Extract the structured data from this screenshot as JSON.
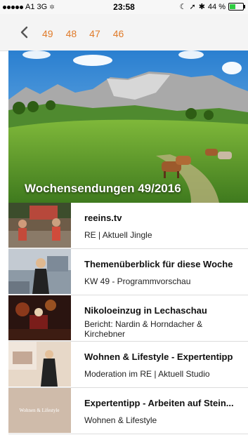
{
  "status_bar": {
    "carrier": "A1",
    "network": "3G",
    "time": "23:58",
    "battery": "44 %",
    "battery_level": 0.44
  },
  "nav": {
    "back_icon": "chevron-left-icon",
    "weeks": [
      "49",
      "48",
      "47",
      "46"
    ],
    "accent": "#e07b2a"
  },
  "hero": {
    "title": "Wochensendungen 49/2016"
  },
  "items": [
    {
      "title": "reeins.tv",
      "subtitle": "RE | Aktuell Jingle"
    },
    {
      "title": "Themenüberblick für diese Woche",
      "subtitle": "KW 49 - Programmvorschau"
    },
    {
      "title": "Nikoloeinzug in Lechaschau",
      "subtitle": "Bericht: Nardin & Horndacher & Kirchebner"
    },
    {
      "title": "Wohnen & Lifestyle - Expertentipp",
      "subtitle": "Moderation im RE | Aktuell Studio"
    },
    {
      "title": "Expertentipp - Arbeiten auf Stein...",
      "subtitle": "Wohnen & Lifestyle"
    }
  ],
  "thumb_texts": {
    "item5_logo": "Wohnen & Lifestyle"
  }
}
